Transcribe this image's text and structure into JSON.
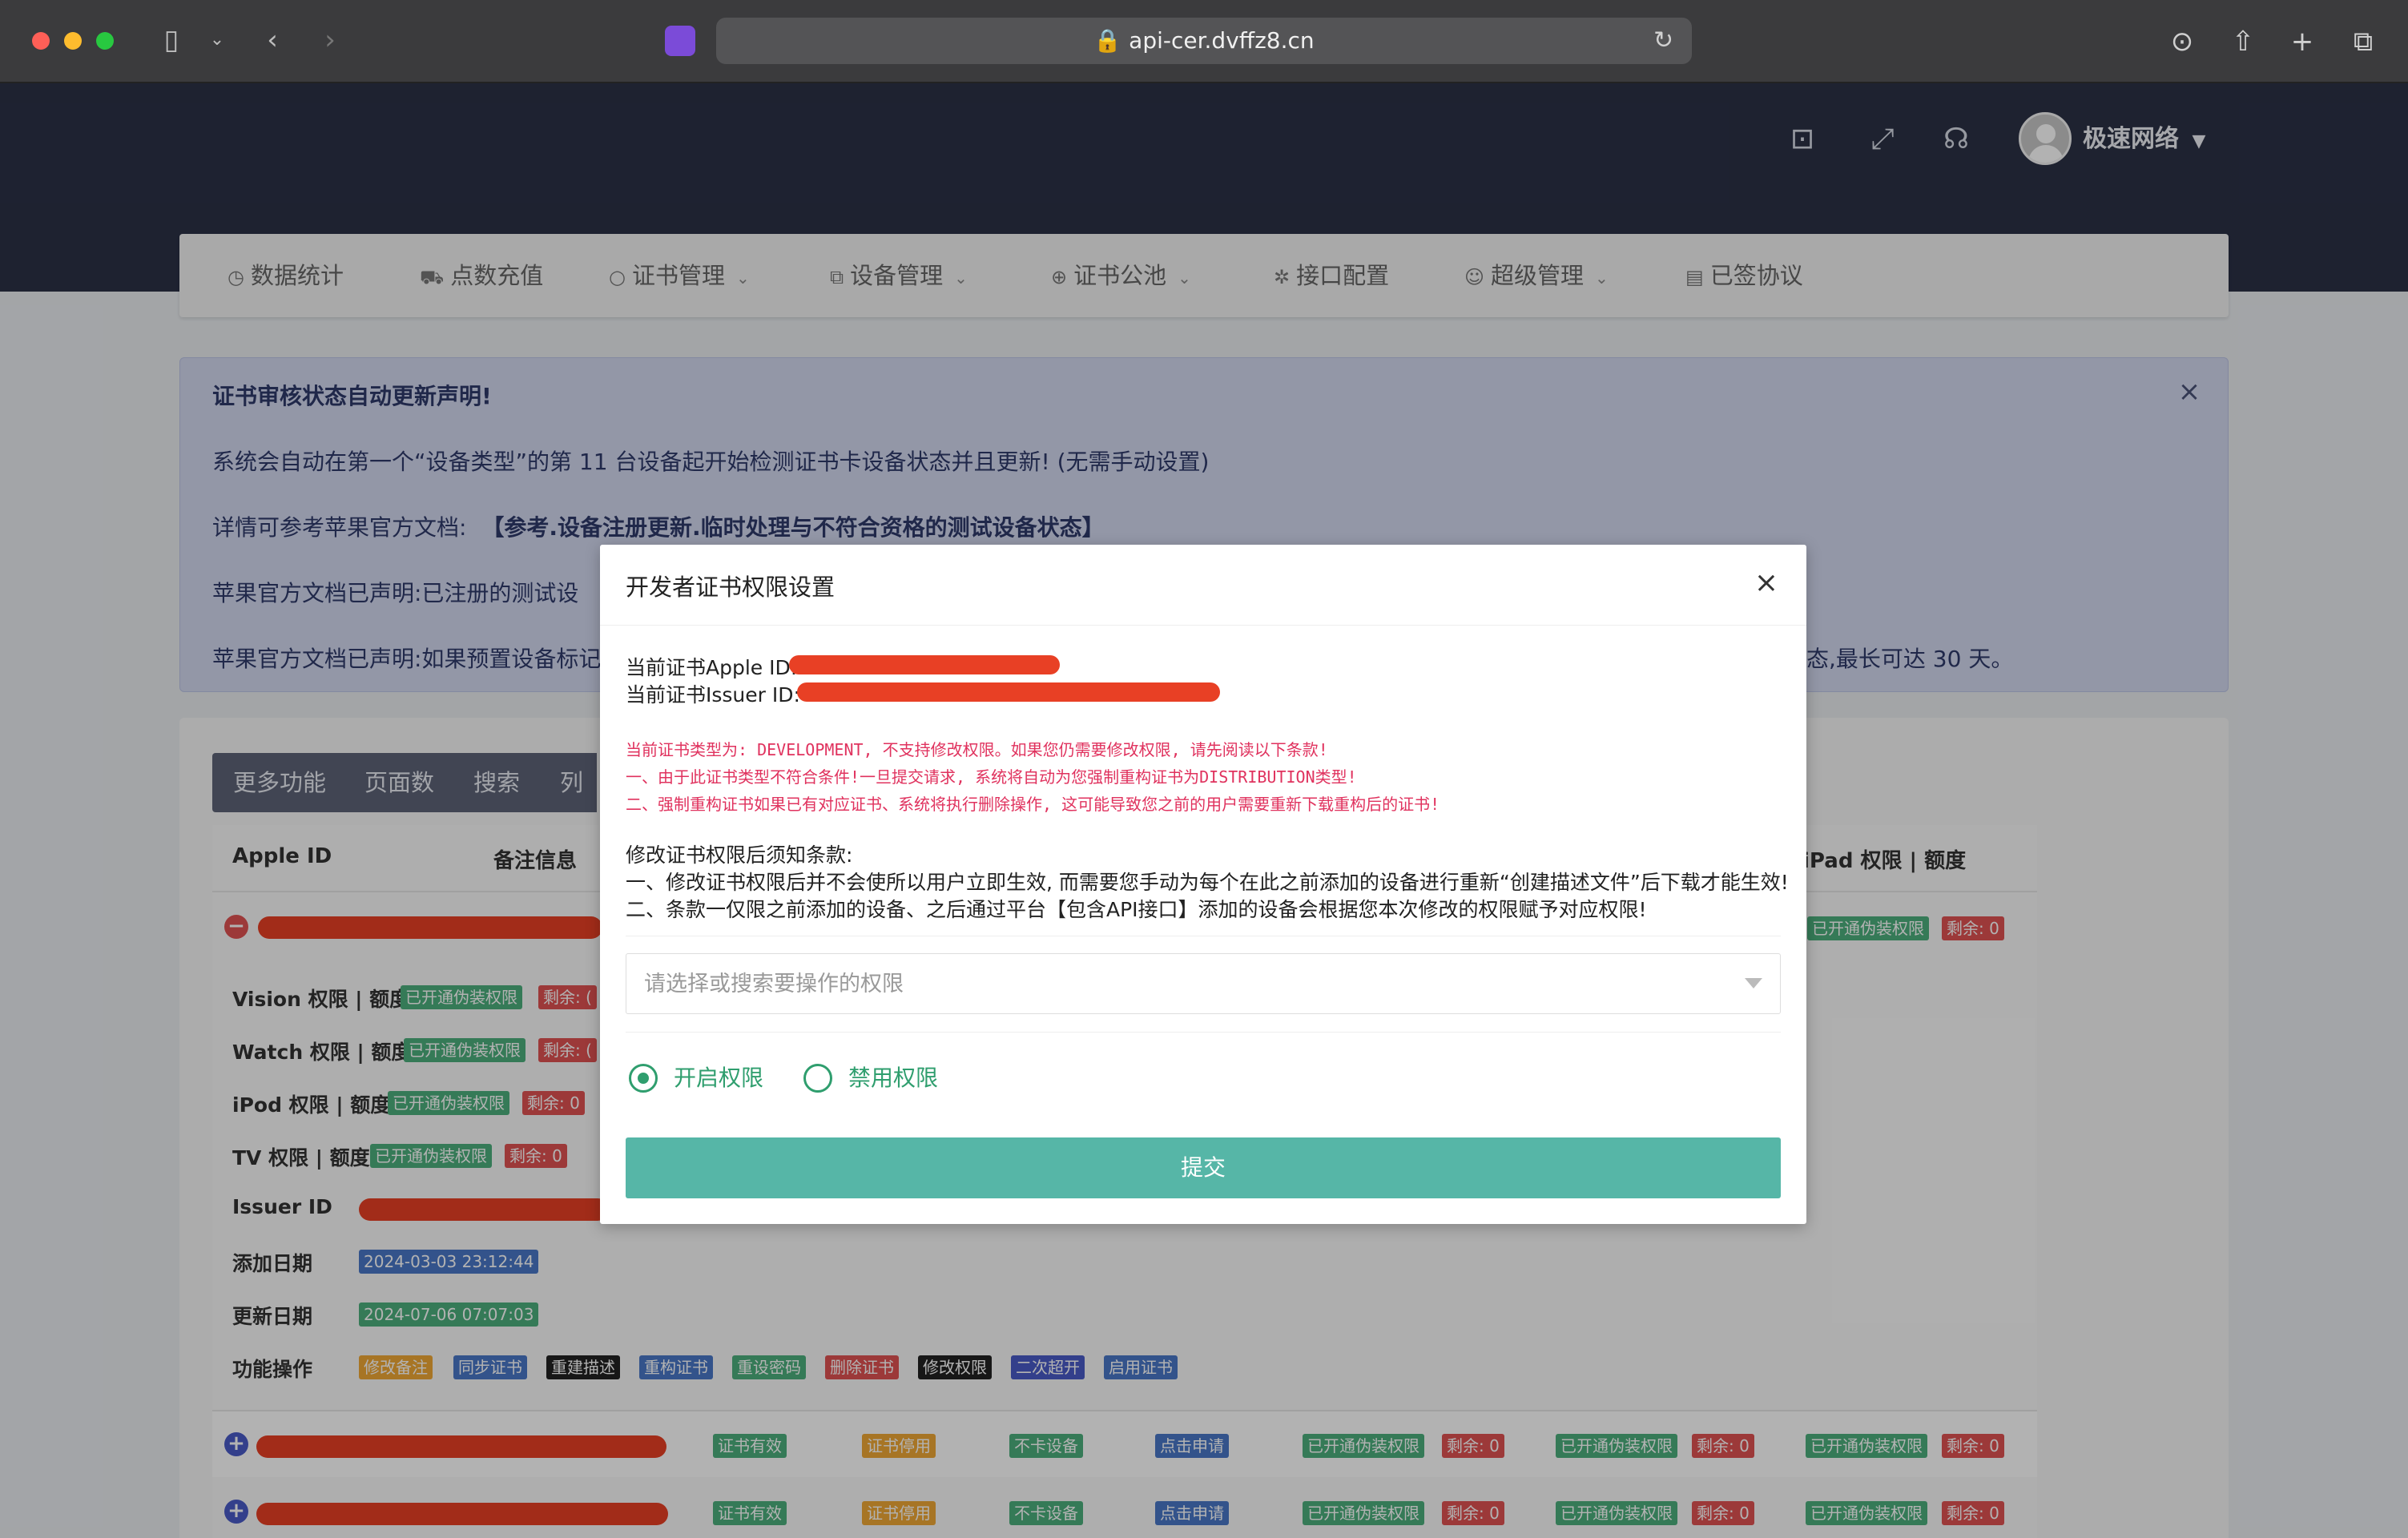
{
  "browser": {
    "url": "api-cer.dvffz8.cn"
  },
  "header": {
    "username": "极速网络"
  },
  "nav": {
    "items": [
      {
        "label": "数据统计",
        "icon": "clock-icon"
      },
      {
        "label": "点数充值",
        "icon": "cart-icon"
      },
      {
        "label": "证书管理",
        "icon": "circle-icon",
        "dropdown": true
      },
      {
        "label": "设备管理",
        "icon": "copy-icon",
        "dropdown": true
      },
      {
        "label": "证书公池",
        "icon": "plus-circle-icon",
        "dropdown": true
      },
      {
        "label": "接口配置",
        "icon": "gear-icon"
      },
      {
        "label": "超级管理",
        "icon": "user-circle-icon",
        "dropdown": true
      },
      {
        "label": "已签协议",
        "icon": "document-icon"
      }
    ]
  },
  "alert": {
    "title": "证书审核状态自动更新声明!",
    "line1": "系统会自动在第一个“设备类型”的第 11 台设备起开始检测证书卡设备状态并且更新!  (无需手动设置)",
    "line2_prefix": "详情可参考苹果官方文档:",
    "line2_link": "【参考.设备注册更新.临时处理与不符合资格的测试设备状态】",
    "line3": "苹果官方文档已声明:已注册的测试设",
    "line4": "苹果官方文档已声明:如果预置设备标记",
    "line4_tail": "态,最长可达 30 天。"
  },
  "table": {
    "tabs": [
      "更多功能",
      "页面数",
      "搜索",
      "列可"
    ],
    "headers": {
      "apple_id": "Apple ID",
      "remark": "备注信息",
      "ipad": "iPad 权限 | 额度"
    },
    "detail": {
      "vision": "Vision 权限 | 额度",
      "watch": "Watch 权限 | 额度",
      "ipod": "iPod 权限 | 额度",
      "tv": "TV 权限 | 额度",
      "issuer": "Issuer ID",
      "added": "添加日期",
      "updated": "更新日期",
      "ops": "功能操作",
      "added_value": "2024-03-03 23:12:44",
      "updated_value": "2024-07-06 07:07:03"
    },
    "tag_fake": "已开通伪装权限",
    "tag_remain": "剩余: 0",
    "tag_remain_short": "剩余: (",
    "ops_buttons": [
      "修改备注",
      "同步证书",
      "重建描述",
      "重构证书",
      "重设密码",
      "删除证书",
      "修改权限",
      "二次超开",
      "启用证书"
    ],
    "row_tags": [
      "证书有效",
      "证书停用",
      "不卡设备",
      "点击申请"
    ]
  },
  "modal": {
    "title": "开发者证书权限设置",
    "apple_id_label": "当前证书Apple ID:",
    "issuer_id_label": "当前证书Issuer ID:",
    "warn1": "当前证书类型为: DEVELOPMENT, 不支持修改权限。如果您仍需要修改权限, 请先阅读以下条款!",
    "warn2": "一、由于此证书类型不符合条件!一旦提交请求, 系统将自动为您强制重构证书为DISTRIBUTION类型!",
    "warn3": "二、强制重构证书如果已有对应证书、系统将执行删除操作, 这可能导致您之前的用户需要重新下载重构后的证书!",
    "notice_title": "修改证书权限后须知条款:",
    "notice1": "一、修改证书权限后并不会使所以用户立即生效, 而需要您手动为每个在此之前添加的设备进行重新“创建描述文件”后下载才能生效!",
    "notice2": "二、条款一仅限之前添加的设备、之后通过平台【包含API接口】添加的设备会根据您本次修改的权限赋予对应权限!",
    "select_placeholder": "请选择或搜索要操作的权限",
    "radio_enable": "开启权限",
    "radio_disable": "禁用权限",
    "submit": "提交"
  },
  "colors": {
    "header_bg": "#2b3146",
    "accent_green": "#2f9e6e",
    "submit_bg": "#56b6a7",
    "warning": "#e0325e",
    "redaction": "#e84025"
  }
}
